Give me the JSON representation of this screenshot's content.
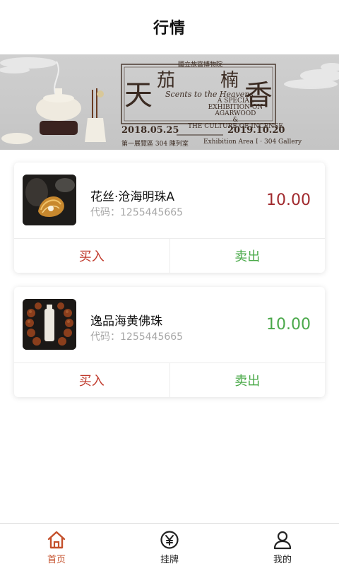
{
  "header": {
    "title": "行情"
  },
  "banner": {
    "title_chars": [
      "天",
      "茄",
      "楠",
      "香"
    ],
    "top_small": "國立故宮博物院",
    "script_text": "Scents to the Heavens",
    "sub_lines": [
      "A SPECIAL",
      "EXHIBITION ON",
      "AGARWOOD",
      "&",
      "THE CULTURE OF INCENSE"
    ],
    "date_start": "2018.05.25",
    "date_end": "2019.10.20",
    "location_cn": "第一展覽區 304 陳列室",
    "location_en": "Exhibition Area I · 304 Gallery"
  },
  "products": [
    {
      "name": "花丝·沧海明珠A",
      "code_label": "代码：",
      "code": "1255445665",
      "price": "10.00",
      "price_color": "#a0292d",
      "buy_label": "买入",
      "sell_label": "卖出"
    },
    {
      "name": "逸品海黄佛珠",
      "code_label": "代码：",
      "code": "1255445665",
      "price": "10.00",
      "price_color": "#4aa84a",
      "buy_label": "买入",
      "sell_label": "卖出"
    }
  ],
  "tabbar": {
    "items": [
      {
        "label": "首页",
        "icon": "home-icon",
        "active": true
      },
      {
        "label": "挂牌",
        "icon": "yen-icon",
        "active": false
      },
      {
        "label": "我的",
        "icon": "user-icon",
        "active": false
      }
    ]
  },
  "colors": {
    "accent": "#c4502b",
    "buy": "#c0392b",
    "sell": "#49a948"
  }
}
